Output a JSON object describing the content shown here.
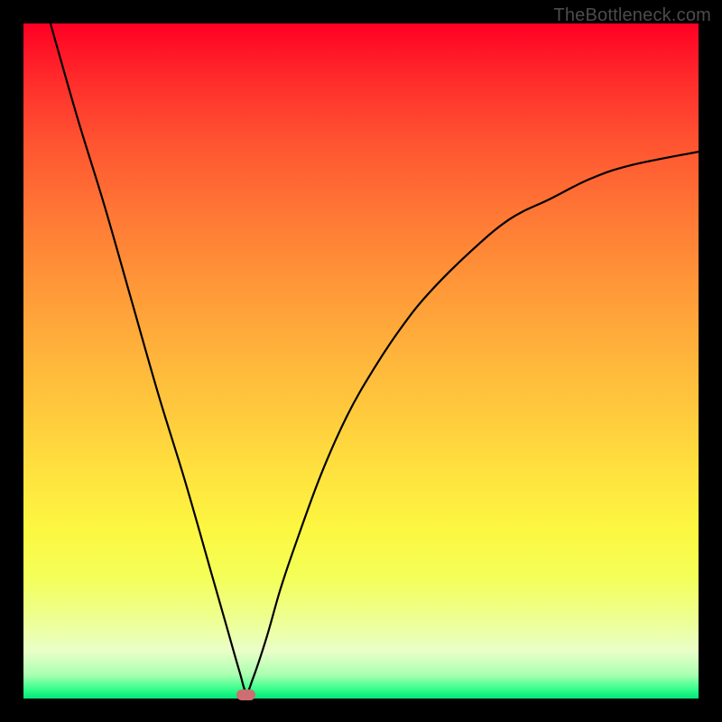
{
  "watermark": "TheBottleneck.com",
  "colors": {
    "background": "#000000",
    "curve": "#000000",
    "marker": "#cc6e72",
    "gradient_top": "#ff0024",
    "gradient_bottom": "#00e877"
  },
  "chart_data": {
    "type": "line",
    "title": "",
    "xlabel": "",
    "ylabel": "",
    "xlim": [
      0,
      100
    ],
    "ylim": [
      0,
      100
    ],
    "x": [
      4,
      8,
      12,
      16,
      20,
      24,
      28,
      30,
      32,
      33,
      34,
      36,
      38,
      40,
      44,
      48,
      52,
      56,
      60,
      66,
      72,
      78,
      84,
      90,
      100
    ],
    "values": [
      100,
      86,
      73,
      59,
      45,
      32,
      18,
      11,
      4,
      1,
      3,
      9,
      16,
      22,
      33,
      42,
      49,
      55,
      60,
      66,
      71,
      74,
      77,
      79,
      81
    ],
    "marker": {
      "x": 33,
      "y": 0.5
    },
    "annotations": []
  }
}
